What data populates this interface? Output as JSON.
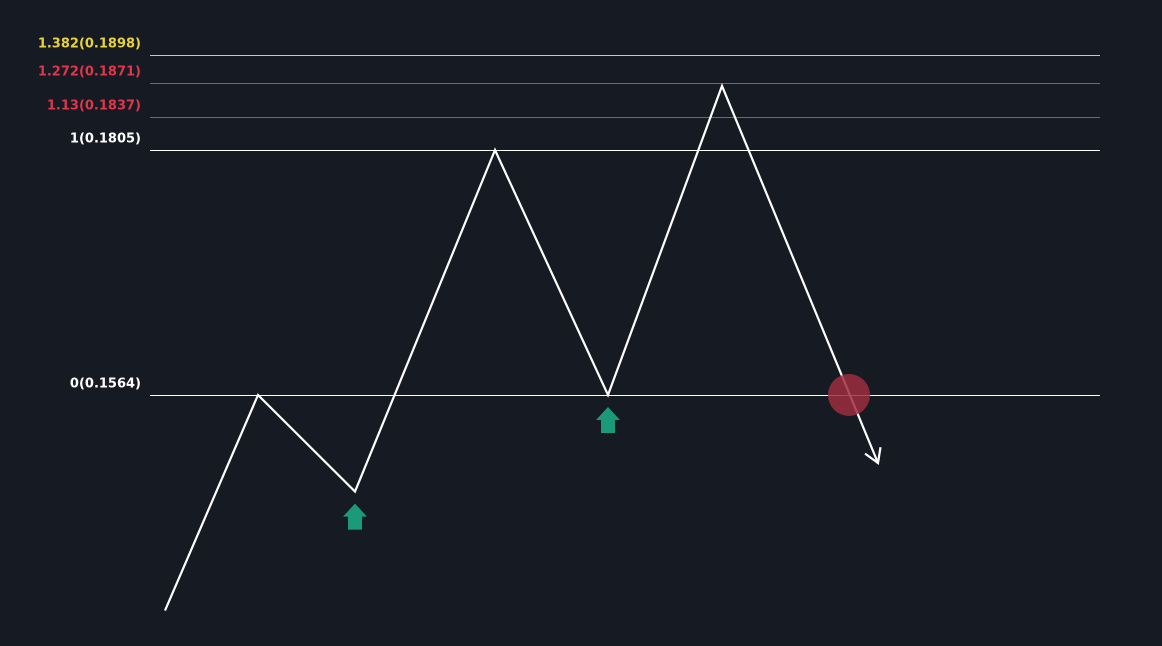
{
  "colors": {
    "background": "#161a23",
    "extension_1382": "#e8d23a",
    "extension_red": "#e0364a",
    "base_levels": "#ffffff",
    "price_path": "#ffffff",
    "buy_arrow": "#1a9a7a",
    "breakdown_marker": "#9e2e40"
  },
  "chart_data": {
    "type": "line",
    "title": "",
    "xlabel": "",
    "ylabel": "",
    "ylim": [
      0.1485,
      0.1925
    ],
    "grid": false,
    "levels": [
      {
        "label": "1.382(0.1898)",
        "ratio": 1.382,
        "price": 0.1898,
        "color": "#e8d23a"
      },
      {
        "label": "1.272(0.1871)",
        "ratio": 1.272,
        "price": 0.1871,
        "color": "#e0364a"
      },
      {
        "label": "1.13(0.1837)",
        "ratio": 1.13,
        "price": 0.1837,
        "color": "#e0364a"
      },
      {
        "label": "1(0.1805)",
        "ratio": 1,
        "price": 0.1805,
        "color": "#ffffff"
      },
      {
        "label": "0(0.1564)",
        "ratio": 0,
        "price": 0.1564,
        "color": "#ffffff"
      }
    ],
    "path": {
      "x": [
        0,
        1,
        2,
        3,
        4,
        5,
        6
      ],
      "y": [
        0.1352,
        0.1564,
        0.1469,
        0.1805,
        0.1564,
        0.1868,
        0.15
      ]
    },
    "markers": {
      "buy_arrows": [
        {
          "x": 2,
          "y": 0.1469
        },
        {
          "x": 4,
          "y": 0.1564
        }
      ],
      "breakdown": {
        "x": 5.8,
        "y": 0.1564
      }
    }
  }
}
